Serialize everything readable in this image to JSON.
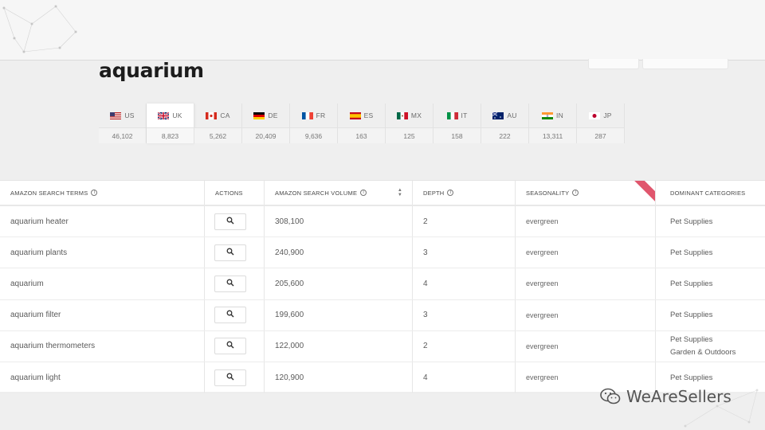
{
  "page": {
    "title": "aquarium"
  },
  "markets": [
    {
      "code": "US",
      "count": "46,102",
      "flag": "us-flag-icon"
    },
    {
      "code": "UK",
      "count": "8,823",
      "flag": "uk-flag-icon",
      "active": true
    },
    {
      "code": "CA",
      "count": "5,262",
      "flag": "ca-flag-icon"
    },
    {
      "code": "DE",
      "count": "20,409",
      "flag": "de-flag-icon"
    },
    {
      "code": "FR",
      "count": "9,636",
      "flag": "fr-flag-icon"
    },
    {
      "code": "ES",
      "count": "163",
      "flag": "es-flag-icon"
    },
    {
      "code": "MX",
      "count": "125",
      "flag": "mx-flag-icon"
    },
    {
      "code": "IT",
      "count": "158",
      "flag": "it-flag-icon"
    },
    {
      "code": "AU",
      "count": "222",
      "flag": "au-flag-icon"
    },
    {
      "code": "IN",
      "count": "13,311",
      "flag": "in-flag-icon"
    },
    {
      "code": "JP",
      "count": "287",
      "flag": "jp-flag-icon"
    }
  ],
  "table": {
    "headers": {
      "terms": "AMAZON SEARCH TERMS",
      "actions": "ACTIONS",
      "volume": "AMAZON SEARCH VOLUME",
      "depth": "DEPTH",
      "seasonality": "SEASONALITY",
      "categories": "DOMINANT CATEGORIES"
    },
    "rows": [
      {
        "term": "aquarium heater",
        "volume": "308,100",
        "depth": "2",
        "seasonality": "evergreen",
        "categories": [
          "Pet Supplies"
        ]
      },
      {
        "term": "aquarium plants",
        "volume": "240,900",
        "depth": "3",
        "seasonality": "evergreen",
        "categories": [
          "Pet Supplies"
        ]
      },
      {
        "term": "aquarium",
        "volume": "205,600",
        "depth": "4",
        "seasonality": "evergreen",
        "categories": [
          "Pet Supplies"
        ]
      },
      {
        "term": "aquarium filter",
        "volume": "199,600",
        "depth": "3",
        "seasonality": "evergreen",
        "categories": [
          "Pet Supplies"
        ]
      },
      {
        "term": "aquarium thermometers",
        "volume": "122,000",
        "depth": "2",
        "seasonality": "evergreen",
        "categories": [
          "Pet Supplies",
          "Garden & Outdoors"
        ]
      },
      {
        "term": "aquarium light",
        "volume": "120,900",
        "depth": "4",
        "seasonality": "evergreen",
        "categories": [
          "Pet Supplies"
        ]
      }
    ]
  },
  "watermark": {
    "text": "WeAreSellers"
  },
  "colors": {
    "ribbon": "#e0566d",
    "background": "#efefef"
  }
}
